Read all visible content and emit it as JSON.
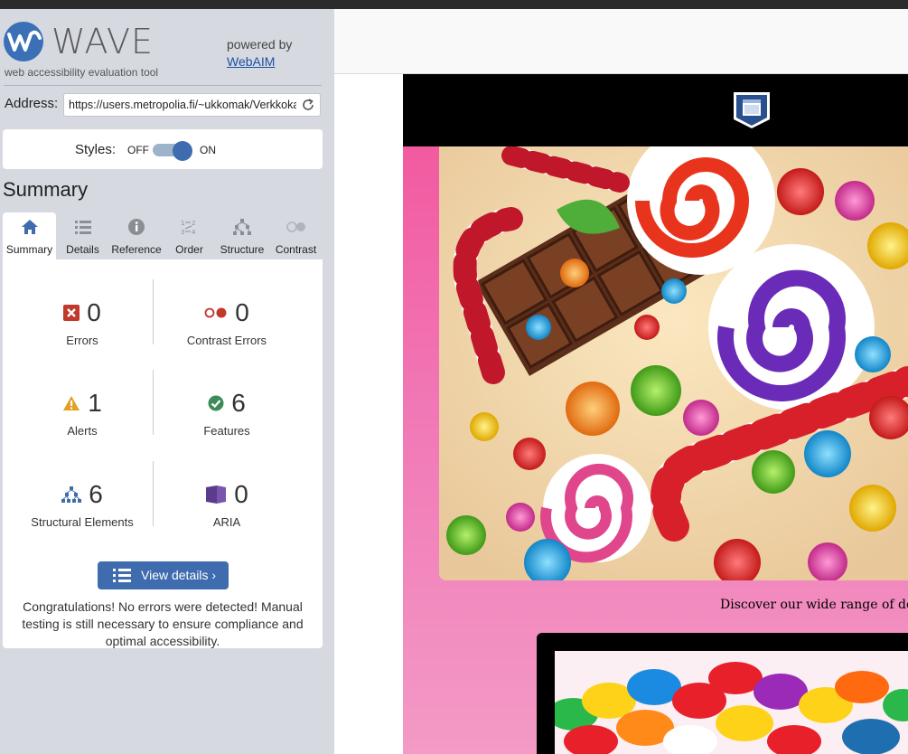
{
  "wave": {
    "brand": "WAVE",
    "tagline": "web accessibility evaluation tool",
    "powered_by": "powered by",
    "webaim_link": "WebAIM",
    "address_label": "Address:",
    "address_value": "https://users.metropolia.fi/~ukkomak/Verkkokauppa",
    "styles_label": "Styles:",
    "styles_off": "OFF",
    "styles_on": "ON",
    "styles_enabled": true,
    "summary_heading": "Summary",
    "tabs": [
      {
        "label": "Summary",
        "icon": "home-icon",
        "active": true
      },
      {
        "label": "Details",
        "icon": "list-icon",
        "active": false
      },
      {
        "label": "Reference",
        "icon": "info-icon",
        "active": false
      },
      {
        "label": "Order",
        "icon": "order-icon",
        "active": false
      },
      {
        "label": "Structure",
        "icon": "structure-icon",
        "active": false
      },
      {
        "label": "Contrast",
        "icon": "contrast-icon",
        "active": false
      }
    ],
    "stats": {
      "errors": {
        "count": "0",
        "label": "Errors",
        "color": "#c0392b"
      },
      "contrast_errors": {
        "count": "0",
        "label": "Contrast Errors",
        "color": "#c0392b"
      },
      "alerts": {
        "count": "1",
        "label": "Alerts",
        "color": "#e0a020"
      },
      "features": {
        "count": "6",
        "label": "Features",
        "color": "#3c8c5a"
      },
      "structural": {
        "count": "6",
        "label": "Structural Elements",
        "color": "#3f6cae"
      },
      "aria": {
        "count": "0",
        "label": "ARIA",
        "color": "#5b3b8c"
      }
    },
    "view_details": "View details ›",
    "congrats": "Congratulations! No errors were detected! Manual testing is still necessary to ensure compliance and optimal accessibility."
  },
  "site": {
    "tagline": "Discover our wide range of delic",
    "colors": {
      "header": "#000000",
      "background": "#f3529a"
    }
  }
}
